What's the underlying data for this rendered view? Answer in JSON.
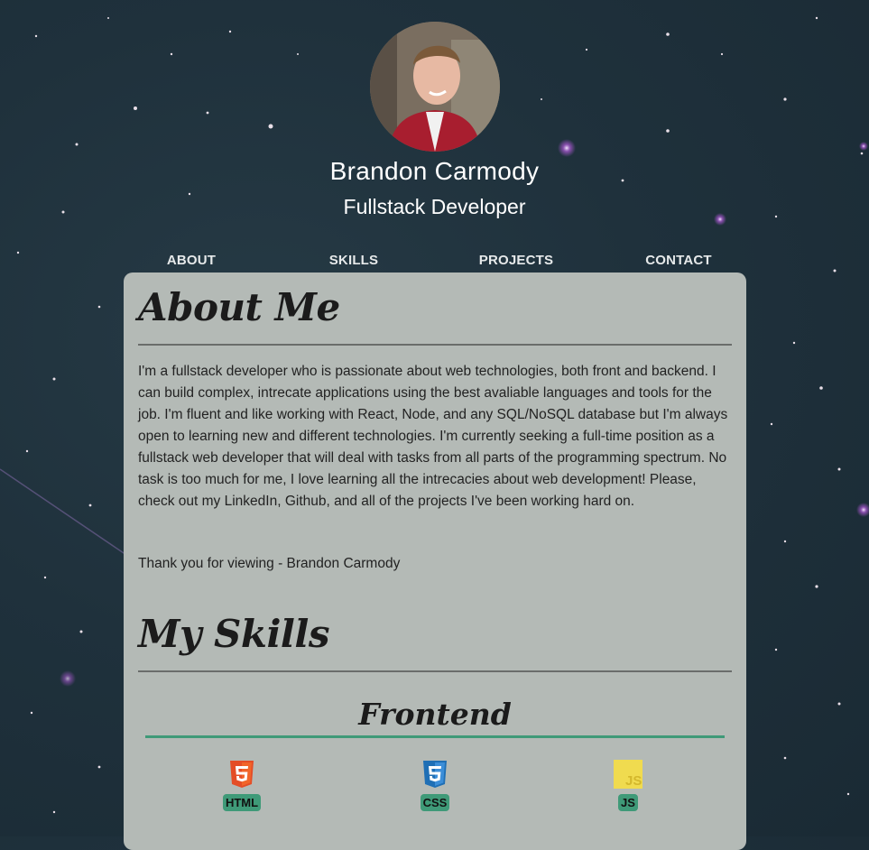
{
  "profile": {
    "name": "Brandon Carmody",
    "role": "Fullstack Developer"
  },
  "nav": [
    {
      "label": "ABOUT"
    },
    {
      "label": "SKILLS"
    },
    {
      "label": "PROJECTS"
    },
    {
      "label": "CONTACT"
    }
  ],
  "about": {
    "title": "About Me",
    "body": "I'm a fullstack developer who is passionate about web technologies, both front and backend. I can build complex, intrecate applications using the best avaliable languages and tools for the job. I'm fluent and like working with React, Node, and any SQL/NoSQL database but I'm always open to learning new and different technologies. I'm currently seeking a full-time position as a fullstack web developer that will deal with tasks from all parts of the programming spectrum. No task is too much for me, I love learning all the intrecacies about web development! Please, check out my LinkedIn, Github, and all of the projects I've been working hard on.",
    "thanks": "Thank you for viewing - Brandon Carmody"
  },
  "skills": {
    "title": "My Skills",
    "frontend_title": "Frontend",
    "items": [
      {
        "label": "HTML",
        "icon": "html5-icon",
        "color": "#e44d26"
      },
      {
        "label": "CSS",
        "icon": "css3-icon",
        "color": "#3c8ed8"
      },
      {
        "label": "JS",
        "icon": "javascript-icon",
        "color": "#f0db4f"
      }
    ]
  },
  "colors": {
    "accent": "#3f9a78",
    "card": "#b4bab6",
    "background": "#1f313c"
  }
}
